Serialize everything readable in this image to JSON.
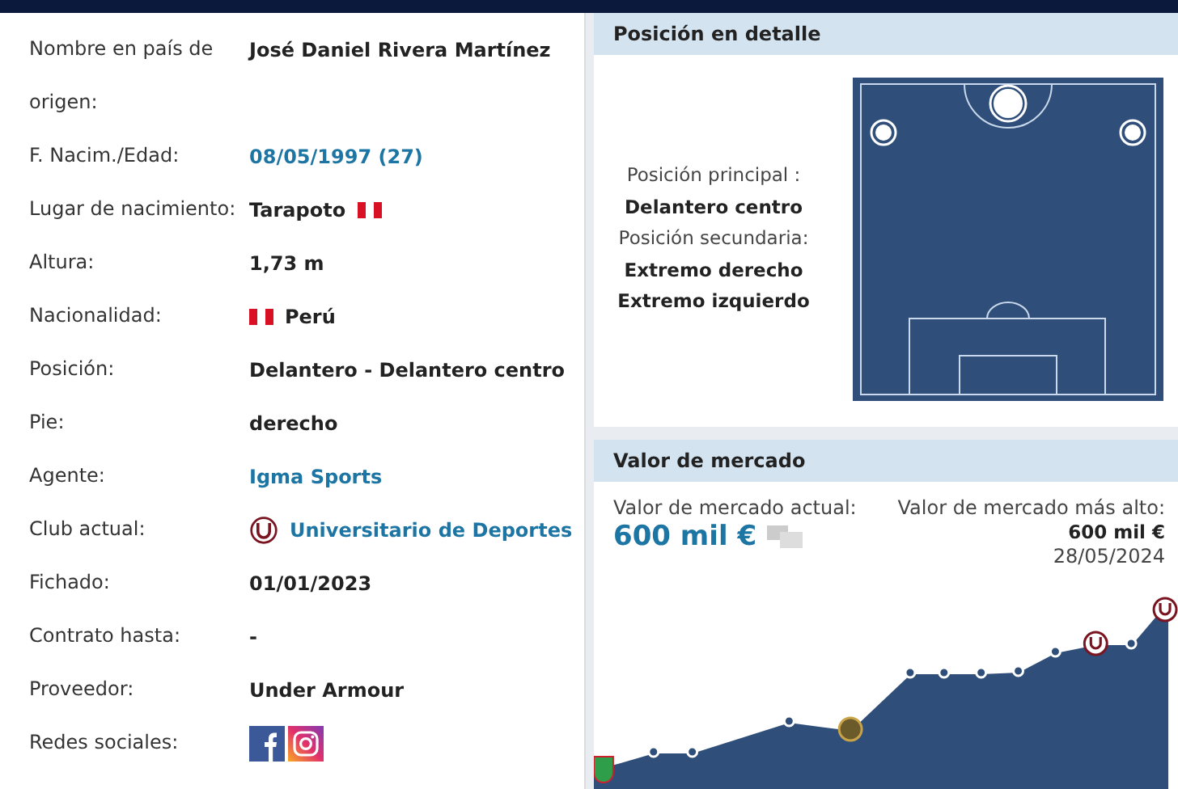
{
  "player_data": {
    "rows": [
      {
        "label": "Nombre en país de origen:",
        "value": "José Daniel Rivera Martínez",
        "kind": "text"
      },
      {
        "label": "F. Nacim./Edad:",
        "value": "08/05/1997 (27)",
        "kind": "link"
      },
      {
        "label": "Lugar de nacimiento:",
        "value": "Tarapoto",
        "kind": "text-flag"
      },
      {
        "label": "Altura:",
        "value": "1,73 m",
        "kind": "text"
      },
      {
        "label": "Nacionalidad:",
        "value": "Perú",
        "kind": "flag-text"
      },
      {
        "label": "Posición:",
        "value": "Delantero - Delantero centro",
        "kind": "text"
      },
      {
        "label": "Pie:",
        "value": "derecho",
        "kind": "text"
      },
      {
        "label": "Agente:",
        "value": "Igma Sports",
        "kind": "link"
      },
      {
        "label": "Club actual:",
        "value": "Universitario de Deportes",
        "kind": "club-link"
      },
      {
        "label": "Fichado:",
        "value": "01/01/2023",
        "kind": "text"
      },
      {
        "label": "Contrato hasta:",
        "value": "-",
        "kind": "text"
      },
      {
        "label": "Proveedor:",
        "value": "Under Armour",
        "kind": "text"
      },
      {
        "label": "Redes sociales:",
        "kind": "social"
      }
    ]
  },
  "position_detail": {
    "title": "Posición en detalle",
    "main_label": "Posición principal :",
    "main": "Delantero centro",
    "secondary_label": "Posición secundaria:",
    "secondary": [
      "Extremo derecho",
      "Extremo izquierdo"
    ]
  },
  "market_value": {
    "title": "Valor de mercado",
    "current_label": "Valor de mercado actual:",
    "current": "600 mil €",
    "highest_label": "Valor de mercado más alto:",
    "highest": "600 mil €",
    "highest_date": "28/05/2024"
  }
}
